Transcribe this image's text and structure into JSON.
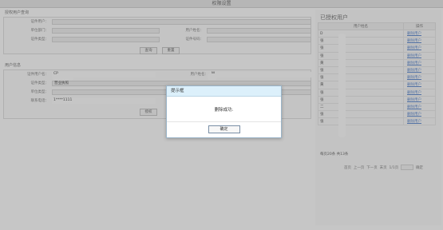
{
  "window": {
    "title": "权限设置"
  },
  "query_section": {
    "title": "授权用户查询",
    "fields": [
      {
        "label": "证件用户：",
        "value": ""
      },
      {
        "label": "单位部门：",
        "value": ""
      },
      {
        "label": "用户姓名：",
        "value": ""
      },
      {
        "label": "证件类型：",
        "value": ""
      },
      {
        "label": "证件号码：",
        "value": ""
      }
    ],
    "query_button": "查询",
    "reset_button": "重置"
  },
  "user_section": {
    "title": "用户信息",
    "fields": [
      {
        "label": "证件用户名：",
        "value": "CP"
      },
      {
        "label": "证件类型：",
        "value": "营业执照"
      },
      {
        "label": "单位类型：",
        "value": ""
      },
      {
        "label": "联系电话：",
        "value": "1****1111"
      },
      {
        "label": "用户姓名：",
        "value": "M"
      }
    ],
    "authorize_button": "授权"
  },
  "authorized_panel": {
    "title": "已授权用户",
    "columns": [
      "用户姓名",
      "操作"
    ],
    "rows": [
      {
        "name": "D",
        "action": "删除用户"
      },
      {
        "name": "张",
        "action": "删除用户"
      },
      {
        "name": "张",
        "action": "删除用户"
      },
      {
        "name": "张",
        "action": "删除用户"
      },
      {
        "name": "黄",
        "action": "删除用户"
      },
      {
        "name": "张",
        "action": "删除用户"
      },
      {
        "name": "张",
        "action": "删除用户"
      },
      {
        "name": "黄",
        "action": "删除用户"
      },
      {
        "name": "张",
        "action": "删除用户"
      },
      {
        "name": "张",
        "action": "删除用户"
      },
      {
        "name": "二",
        "action": "删除用户"
      },
      {
        "name": "张",
        "action": "删除用户"
      },
      {
        "name": "张",
        "action": "删除用户"
      }
    ],
    "total_text": "每页20条 共13条",
    "pager": {
      "first": "首页",
      "prev": "上一页",
      "next": "下一页",
      "last": "末页",
      "page_text": "1/1页",
      "go": "确定"
    }
  },
  "dialog": {
    "title": "提示框",
    "message": "删除成功.",
    "ok_button": "确定"
  }
}
